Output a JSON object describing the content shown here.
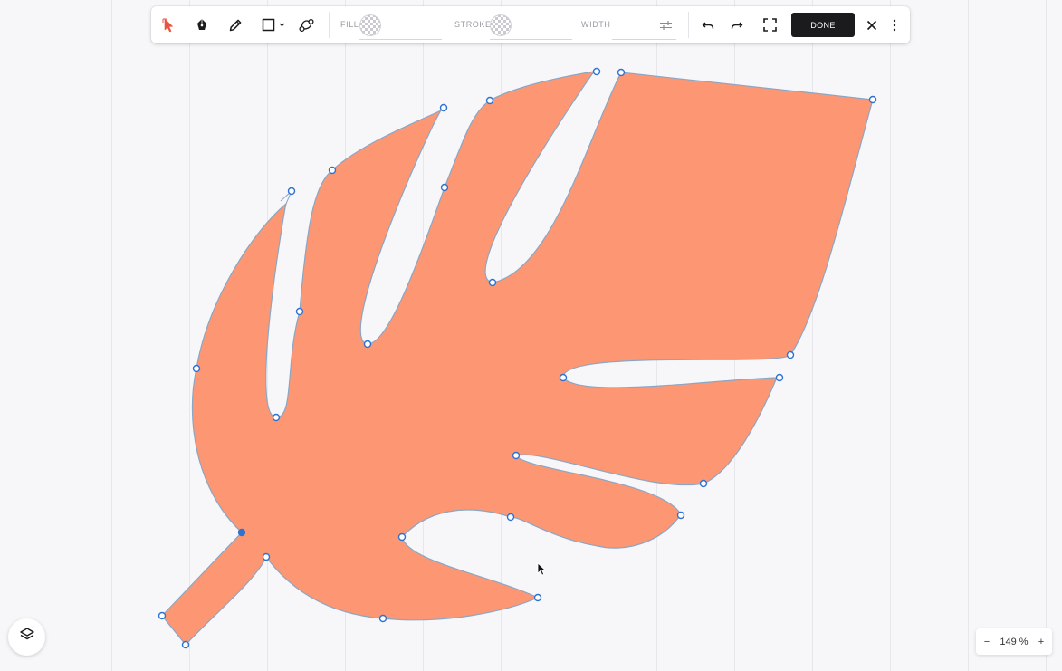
{
  "toolbar": {
    "tools": [
      {
        "id": "select",
        "icon": "select-arrow-icon",
        "active": true
      },
      {
        "id": "pen",
        "icon": "pen-nib-icon"
      },
      {
        "id": "pencil",
        "icon": "pencil-icon"
      },
      {
        "id": "shape",
        "icon": "rectangle-icon"
      },
      {
        "id": "path",
        "icon": "path-node-icon"
      }
    ],
    "fill_label": "FILL",
    "stroke_label": "STROKE",
    "width_label": "WIDTH",
    "done_label": "DONE"
  },
  "zoom": {
    "minus": "−",
    "value": "149 %",
    "plus": "+"
  },
  "colors": {
    "leaf_fill": "#fd9773",
    "leaf_stroke": "#8aa6c4",
    "node_stroke": "#2e72d2",
    "accent_red": "#e8553e"
  }
}
